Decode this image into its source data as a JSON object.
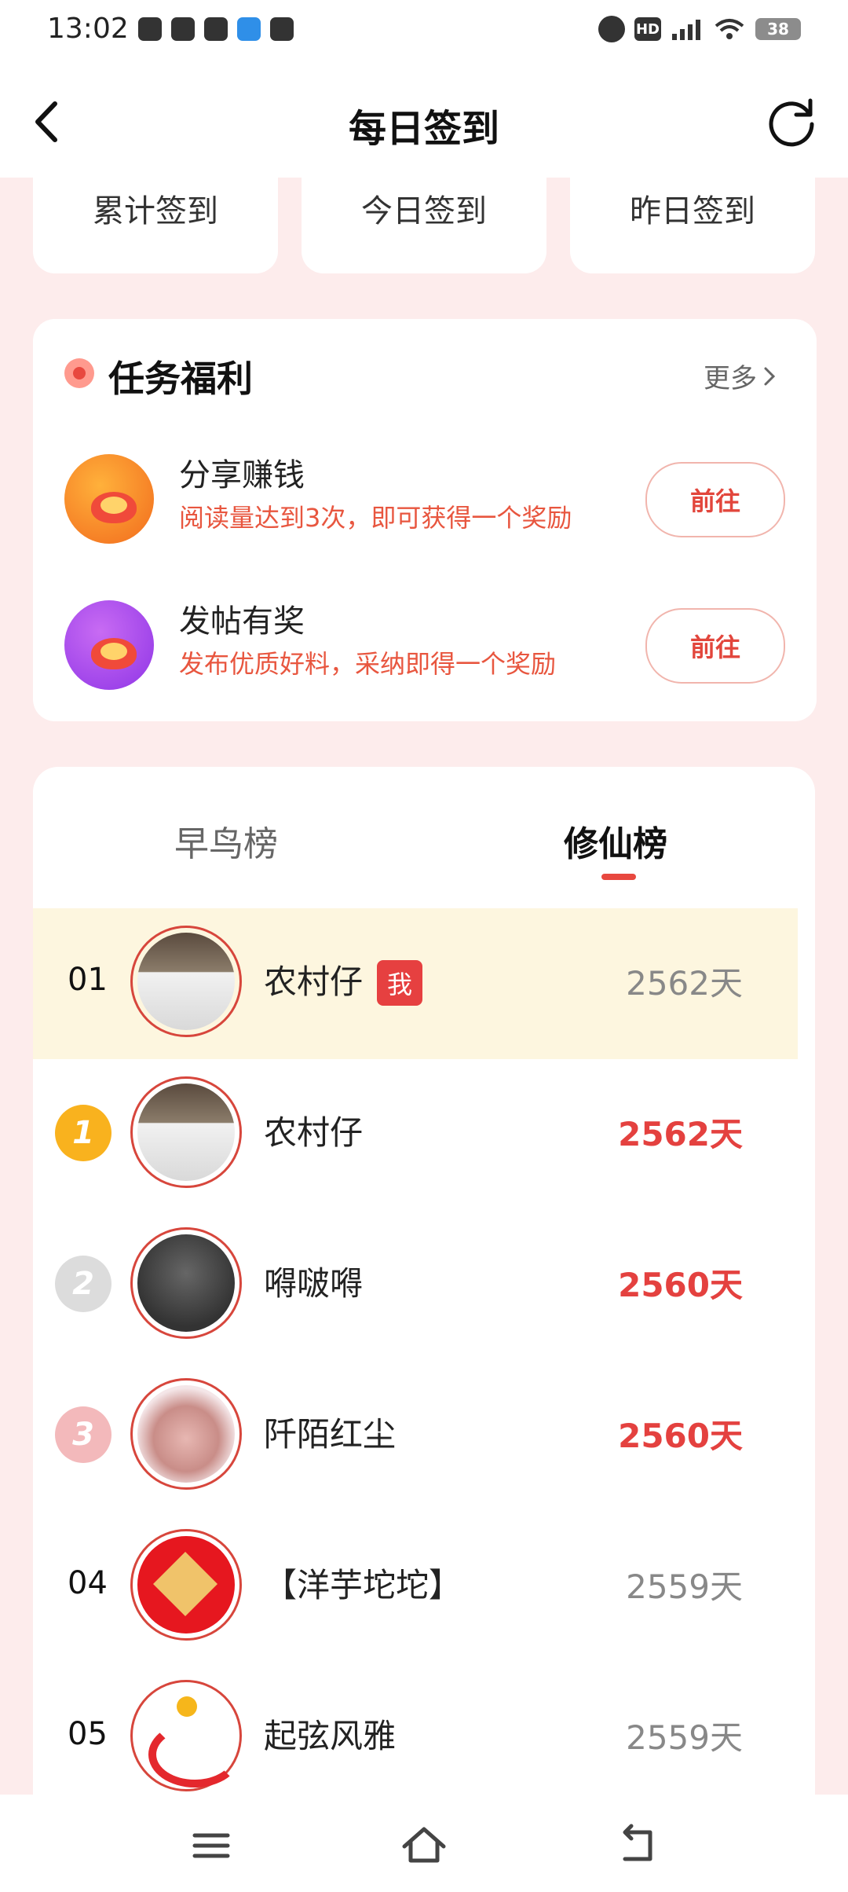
{
  "status_bar": {
    "time": "13:02",
    "hd": "HD",
    "battery": "38"
  },
  "header": {
    "title": "每日签到"
  },
  "stats": [
    "累计签到",
    "今日签到",
    "昨日签到"
  ],
  "tasks": {
    "title": "任务福利",
    "more": "更多",
    "items": [
      {
        "name": "分享赚钱",
        "desc": "阅读量达到3次，即可获得一个奖励",
        "button": "前往",
        "icon": "share-reward-icon"
      },
      {
        "name": "发帖有奖",
        "desc": "发布优质好料，采纳即得一个奖励",
        "button": "前往",
        "icon": "post-reward-icon"
      }
    ]
  },
  "ranking": {
    "tabs": [
      "早鸟榜",
      "修仙榜"
    ],
    "active_tab": "修仙榜",
    "me": {
      "rank": "01",
      "name": "农村仔",
      "badge": "我",
      "days": "2562天"
    },
    "rows": [
      {
        "rank": "1",
        "name": "农村仔",
        "days": "2562天"
      },
      {
        "rank": "2",
        "name": "嘚啵嘚",
        "days": "2560天"
      },
      {
        "rank": "3",
        "name": "阡陌红尘",
        "days": "2560天"
      },
      {
        "rank": "04",
        "name": "【洋芋坨坨】",
        "days": "2559天"
      },
      {
        "rank": "05",
        "name": "起弦风雅",
        "days": "2559天"
      }
    ]
  },
  "colors": {
    "accent": "#e8483f",
    "page_bg": "#fdecec",
    "me_row_bg": "#fdf6df"
  }
}
